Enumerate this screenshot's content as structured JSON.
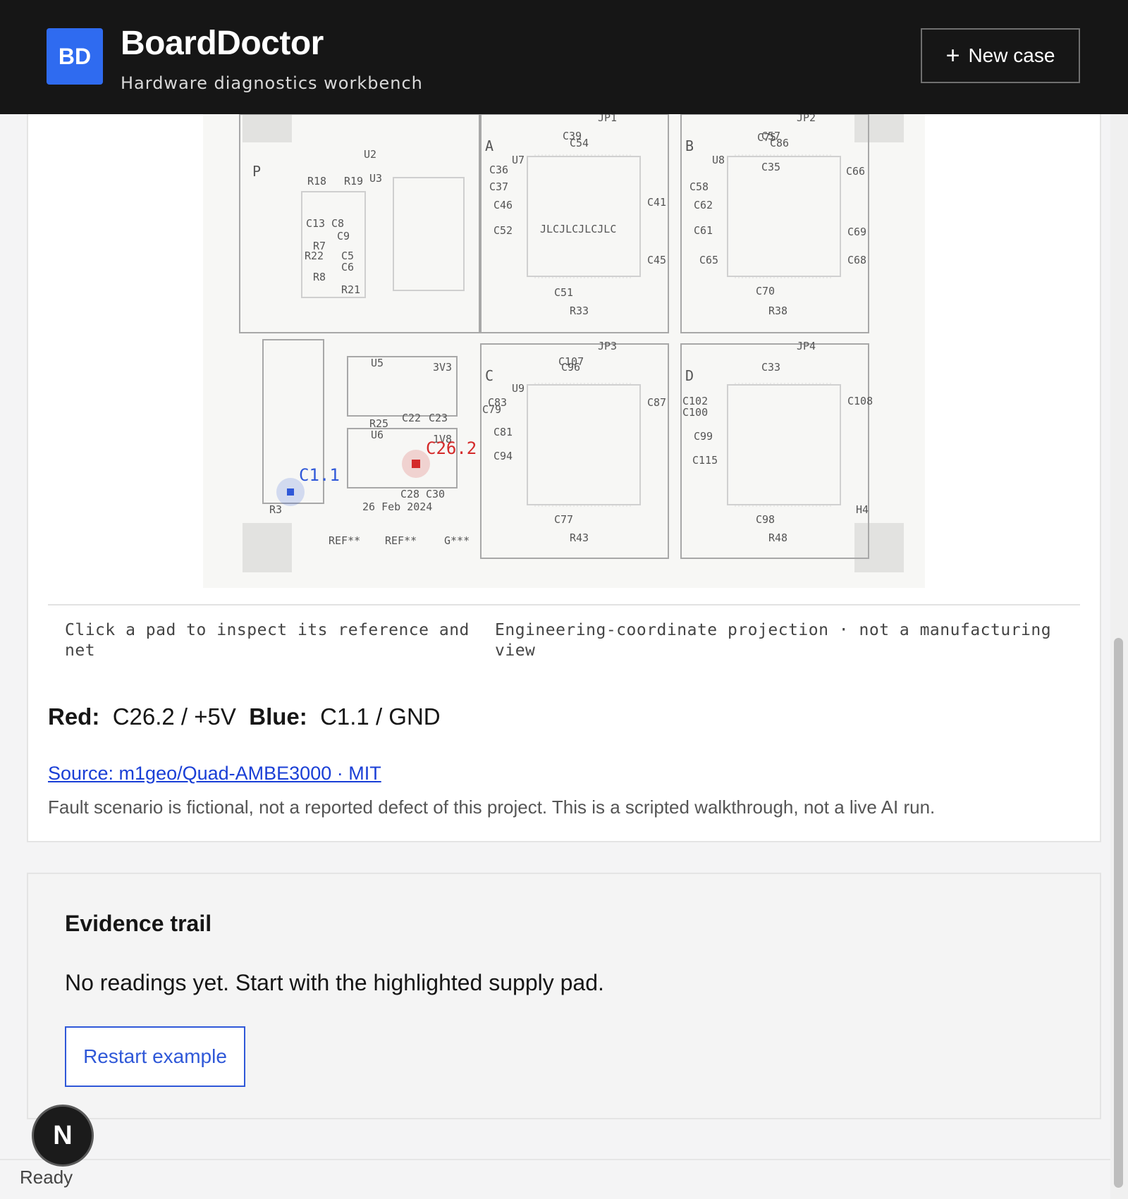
{
  "header": {
    "logo_text": "BD",
    "app_name": "BoardDoctor",
    "tagline": "Hardware diagnostics workbench",
    "new_case_label": "New case"
  },
  "board": {
    "quadrant_labels": [
      "A",
      "B",
      "C",
      "D",
      "P"
    ],
    "jumpers": [
      "JP1",
      "JP2",
      "JP3",
      "JP4"
    ],
    "chip_marking": "JLCJLCJLCJLC",
    "date_text": "26 Feb 2024",
    "ref_labels": [
      "REF**",
      "REF**",
      "G***"
    ],
    "misc_labels": [
      "H4",
      "R3",
      "3V3",
      "1V8",
      "U5",
      "U6",
      "R25",
      "C22",
      "C23",
      "C28",
      "C30",
      "C51",
      "C70",
      "C77",
      "C98",
      "R33",
      "R38",
      "R43",
      "R48",
      "C115",
      "C99",
      "C94",
      "C81",
      "C79",
      "C62",
      "C61",
      "C52",
      "C46",
      "C9",
      "C5",
      "C6",
      "R7",
      "R8",
      "R21",
      "R22",
      "R18",
      "R19",
      "U2",
      "U3",
      "U7",
      "U8",
      "U9",
      "C13",
      "C8",
      "C36",
      "C37",
      "C58",
      "C66",
      "C108",
      "C100",
      "C102",
      "C83",
      "C87",
      "C41",
      "C45",
      "C65",
      "C68",
      "C69",
      "C35",
      "C39",
      "C57",
      "C75",
      "C96",
      "C33",
      "C54",
      "C86",
      "C107"
    ],
    "marker_red_label": "C26.2",
    "marker_blue_label": "C1.1",
    "accent_red": "#d42a2a",
    "accent_blue": "#2f58d8"
  },
  "captions": {
    "left": "Click a pad to inspect its reference and net",
    "right": "Engineering-coordinate projection · not a manufacturing view"
  },
  "probes": {
    "red_label": "Red:",
    "red_value": "C26.2 / +5V",
    "blue_label": "Blue:",
    "blue_value": "C1.1 / GND"
  },
  "source_link": "Source: m1geo/Quad-AMBE3000 · MIT",
  "disclaimer": "Fault scenario is fictional, not a reported defect of this project. This is a scripted walkthrough, not a live AI run.",
  "evidence": {
    "title": "Evidence trail",
    "empty_text": "No readings yet. Start with the highlighted supply pad.",
    "restart_label": "Restart example"
  },
  "status": {
    "badge_letter": "N",
    "ready_text": "Ready"
  }
}
